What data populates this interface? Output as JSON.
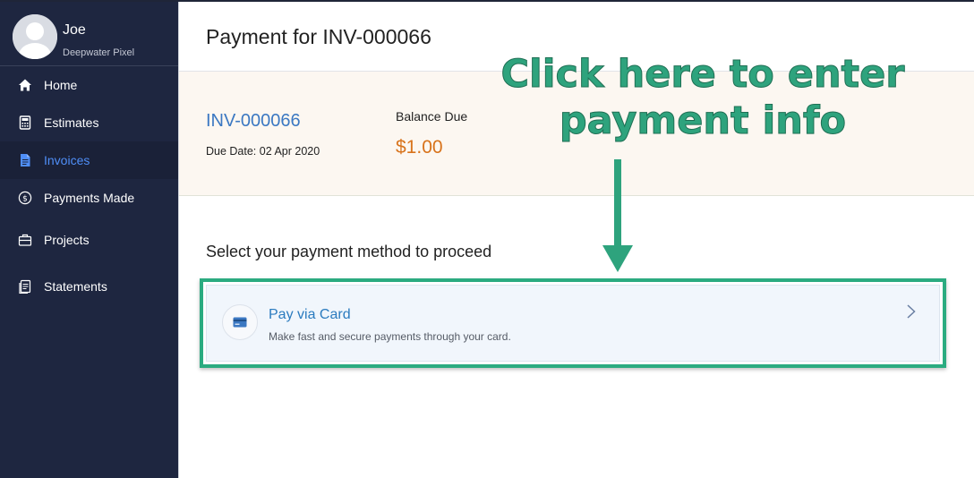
{
  "profile": {
    "name": "Joe",
    "organization": "Deepwater Pixel"
  },
  "sidebar": {
    "items": [
      {
        "label": "Home",
        "icon": "home-icon",
        "active": false
      },
      {
        "label": "Estimates",
        "icon": "calculator-icon",
        "active": false
      },
      {
        "label": "Invoices",
        "icon": "document-icon",
        "active": true
      },
      {
        "label": "Payments Made",
        "icon": "dollar-circle-icon",
        "active": false
      },
      {
        "label": "Projects",
        "icon": "briefcase-icon",
        "active": false
      },
      {
        "label": "Statements",
        "icon": "statement-icon",
        "active": false
      }
    ]
  },
  "header": {
    "title": "Payment for INV-000066"
  },
  "invoice": {
    "number": "INV-000066",
    "due_date": "Due Date: 02 Apr 2020",
    "balance_label": "Balance Due",
    "balance_amount": "$1.00"
  },
  "payment": {
    "prompt": "Select your payment method to proceed",
    "method_title": "Pay via Card",
    "method_description": "Make fast and secure payments through your card.",
    "method_icon": "credit-card-icon"
  },
  "annotation": {
    "line1": "Click here to enter",
    "line2": "payment info"
  },
  "colors": {
    "sidebar_bg": "#1e2640",
    "active_nav": "#4f8ef7",
    "link_blue": "#3b78c2",
    "amount_orange": "#d8731b",
    "annotation_green": "#2ea37d"
  }
}
